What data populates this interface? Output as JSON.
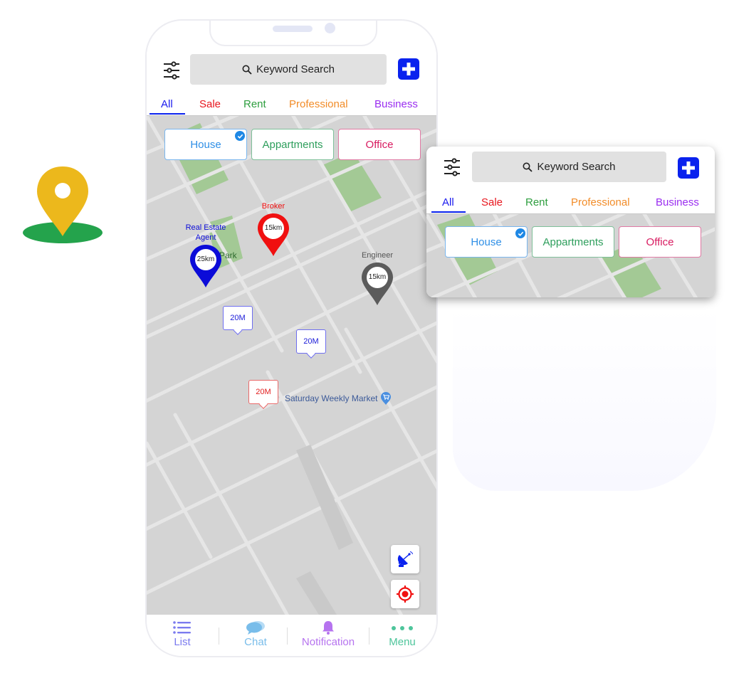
{
  "header": {
    "search_placeholder": "Keyword Search",
    "filter_icon": "sliders-icon",
    "add_icon": "plus-icon"
  },
  "tabs": [
    {
      "label": "All",
      "color": "#1a1aee",
      "active": true
    },
    {
      "label": "Sale",
      "color": "#e8161e"
    },
    {
      "label": "Rent",
      "color": "#2e9e3f"
    },
    {
      "label": "Professional",
      "color": "#f28c28"
    },
    {
      "label": "Business",
      "color": "#9a2df0"
    }
  ],
  "chips": [
    {
      "label": "House",
      "color": "#2f8fe6",
      "border": "#7ab6ee",
      "selected": true
    },
    {
      "label": "Appartments",
      "color": "#2e9e5c",
      "border": "#7fc09a",
      "selected": false
    },
    {
      "label": "Office",
      "color": "#d81b60",
      "border": "#e07aa4",
      "selected": false
    }
  ],
  "markers": [
    {
      "label": "Real Estate Agent",
      "line1": "Real Estate",
      "line2": "Agent",
      "distance": "25km",
      "color": "#0b0bd8"
    },
    {
      "label": "Broker",
      "distance": "15km",
      "color": "#f01010"
    },
    {
      "label": "Engineer",
      "distance": "15km",
      "color": "#5b5b5b"
    }
  ],
  "price_tags": [
    {
      "label": "20M",
      "color": "#1a1ad8",
      "border": "#6e6ef0"
    },
    {
      "label": "20M",
      "color": "#1a1ad8",
      "border": "#6e6ef0"
    },
    {
      "label": "20M",
      "color": "#e21d1d",
      "border": "#ea6a6a"
    }
  ],
  "map": {
    "park_label": "Park",
    "poi_label": "Saturday Weekly Market",
    "poi_icon": "shopping-cart-icon"
  },
  "map_buttons": [
    {
      "name": "satellite-button",
      "icon": "satellite-dish-icon",
      "color": "#0a22ee"
    },
    {
      "name": "my-location-button",
      "icon": "target-icon",
      "color": "#f01010"
    }
  ],
  "bottom_nav": [
    {
      "label": "List",
      "icon": "list-icon",
      "color": "#7b7bef"
    },
    {
      "label": "Chat",
      "icon": "chat-bubbles-icon",
      "color": "#79bdea"
    },
    {
      "label": "Notification",
      "icon": "bell-icon",
      "color": "#b673ef"
    },
    {
      "label": "Menu",
      "icon": "dots-icon",
      "color": "#4ec59b"
    }
  ],
  "colors": {
    "accent": "#0a22ee",
    "map_bg": "#d4d4d4",
    "map_road": "#e6e6e6",
    "park": "#a3c995",
    "hero_pin": "#ecb81c",
    "hero_base": "#24a34c"
  }
}
